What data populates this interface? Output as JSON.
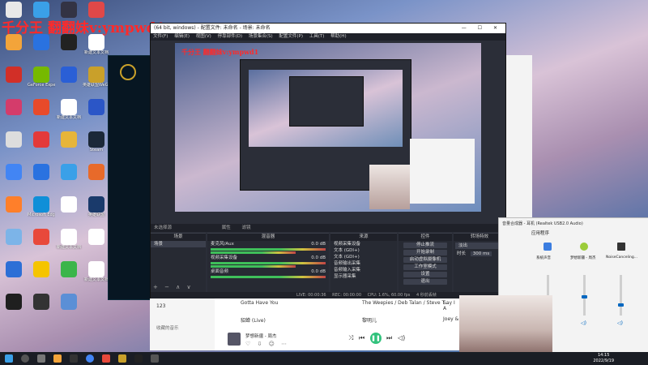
{
  "watermark": {
    "text": "千分王 翻翻妹v:ympwd1",
    "small": "千分王 翻翻妹v:ympwd1"
  },
  "desktop_icons": [
    {
      "label": "",
      "color": "#e8e8e8"
    },
    {
      "label": "",
      "color": "#f3a43a"
    },
    {
      "label": "",
      "color": "#d22f27"
    },
    {
      "label": "",
      "color": "#d43c6b"
    },
    {
      "label": "",
      "color": "#ddd"
    },
    {
      "label": "",
      "color": "#4285f4"
    },
    {
      "label": "",
      "color": "#ff7f2a"
    },
    {
      "label": "",
      "color": "#7cb4e8"
    },
    {
      "label": "",
      "color": "#2d6fd6"
    },
    {
      "label": "",
      "color": "#1f1f1f"
    },
    {
      "label": "",
      "color": "#3aa0e8"
    },
    {
      "label": "",
      "color": "#2a72e0"
    },
    {
      "label": "GeForce Experience",
      "color": "#76b900"
    },
    {
      "label": "",
      "color": "#e84a2a"
    },
    {
      "label": "",
      "color": "#e33a3a"
    },
    {
      "label": "",
      "color": "#2a72e0"
    },
    {
      "label": "Microsoft Edge",
      "color": "#0f8fd8"
    },
    {
      "label": "",
      "color": "#e8493b"
    },
    {
      "label": "",
      "color": "#f5c400"
    },
    {
      "label": "",
      "color": "#333"
    },
    {
      "label": "",
      "color": "#334"
    },
    {
      "label": "",
      "color": "#222"
    },
    {
      "label": "",
      "color": "#2a5fd6"
    },
    {
      "label": "新建文本文档",
      "color": "#fff"
    },
    {
      "label": "",
      "color": "#e6b53a"
    },
    {
      "label": "",
      "color": "#3aa0e8"
    },
    {
      "label": "",
      "color": "#fff"
    },
    {
      "label": "新建文本文档",
      "color": "#fff"
    },
    {
      "label": "",
      "color": "#3bb54a"
    },
    {
      "label": "",
      "color": "#5b8fd6"
    },
    {
      "label": "",
      "color": "#e04848"
    },
    {
      "label": "新建文本文档",
      "color": "#fff"
    },
    {
      "label": "英雄联盟WeGame版",
      "color": "#c9a02a"
    },
    {
      "label": "",
      "color": "#2b56c7"
    },
    {
      "label": "Steam",
      "color": "#1b2838"
    },
    {
      "label": "",
      "color": "#e86a2a"
    },
    {
      "label": "英雄联盟",
      "color": "#1a3a6b"
    },
    {
      "label": "",
      "color": "#fff"
    },
    {
      "label": "新建文本文档",
      "color": "#fff"
    }
  ],
  "obs": {
    "title": "(64 bit, windows) - 配置文件: 未命名 - 场景: 未命名",
    "window_controls": "— ☐ ✕",
    "menu": [
      "文件(F)",
      "编辑(E)",
      "视图(V)",
      "停靠部件(D)",
      "场景集合(S)",
      "配置文件(P)",
      "工具(T)",
      "帮助(H)"
    ],
    "no_source": "未选择源",
    "properties": "属性",
    "filters": "滤镜",
    "scenes_header": "场景",
    "scene_item": "场景",
    "sources_header": "来源",
    "sources": [
      "视频采集设备",
      "文本 (GDI+)",
      "文本 (GDI+)",
      "音频输出采集",
      "音频输入采集",
      "显示器采集"
    ],
    "mixer_header": "混音器",
    "mixer_tracks": [
      {
        "name": "麦克风/Aux",
        "db": "0.0 dB"
      },
      {
        "name": "视频采集设备",
        "db": "0.0 dB"
      },
      {
        "name": "桌面音频",
        "db": "0.0 dB"
      }
    ],
    "controls_header": "控件",
    "controls": [
      "停止推流",
      "开始录制",
      "启动虚拟摄像机",
      "工作室模式",
      "设置",
      "退出"
    ],
    "transitions_header": "转场特效",
    "transition": "淡出",
    "duration_label": "时长",
    "duration": "300 ms",
    "status": {
      "live": "LIVE: 00:00:36",
      "rec": "REC: 00:00:00",
      "cpu": "CPU: 1.6%, 60.00 fps",
      "kbps": "4 秒前丢帧",
      "fps": "kb/s: 0"
    }
  },
  "music": {
    "sidebar_item1": "123",
    "sidebar_item2": "收藏的音乐",
    "songs": [
      {
        "title": "Gotta Have You",
        "artist": "The Weepies / Deb Talan / Steve T...",
        "album": "Say I A"
      },
      {
        "title": "貂蝉 (Live)",
        "artist": "黎明儿",
        "album": "Joey &"
      }
    ],
    "now_playing": "梦想新疆",
    "now_artist": "- 周杰"
  },
  "volume_mixer": {
    "title": "音量合成器 - 耳机 (Realtek USB2.0 Audio)",
    "section": "应用程序",
    "apps": [
      "系统声音",
      "梦想新疆 - 周杰",
      "NoiseCanceling..."
    ],
    "levels": [
      0.3,
      0.45,
      0.25
    ]
  },
  "clock": {
    "time": "14:15",
    "date": "2022/9/19"
  }
}
